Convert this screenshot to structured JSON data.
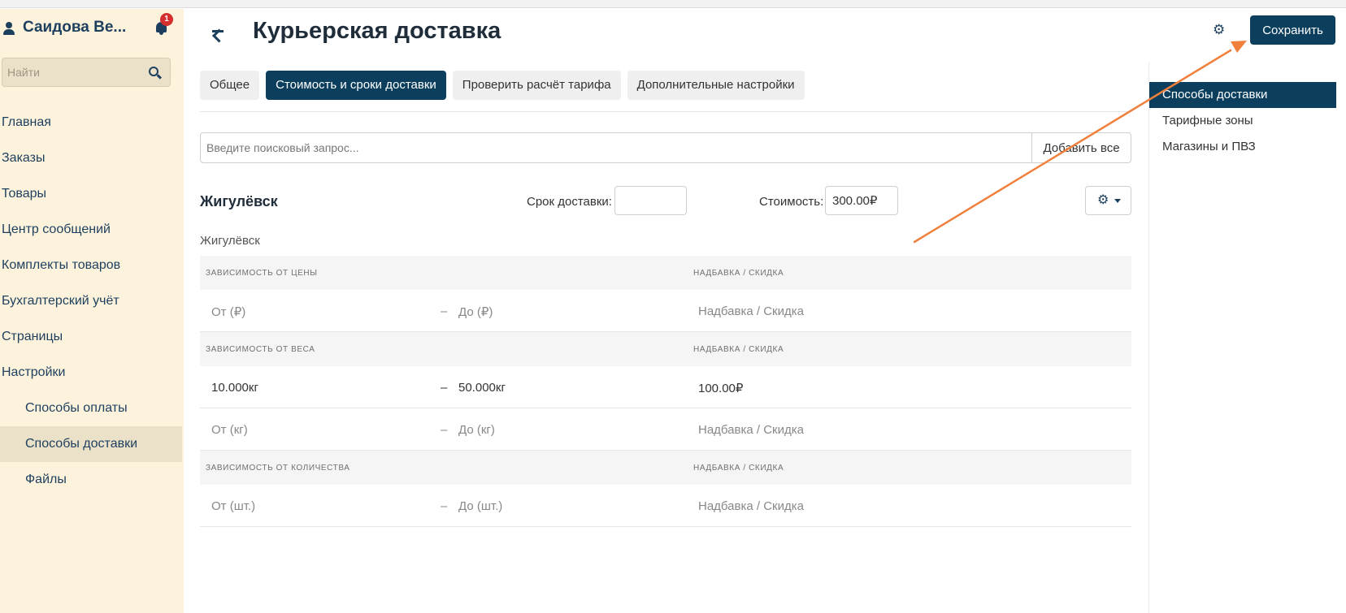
{
  "sidebar": {
    "user_name": "Саидова Ве...",
    "notification_count": "1",
    "search_placeholder": "Найти",
    "items": [
      {
        "label": "Главная"
      },
      {
        "label": "Заказы"
      },
      {
        "label": "Товары"
      },
      {
        "label": "Центр сообщений"
      },
      {
        "label": "Комплекты товаров"
      },
      {
        "label": "Бухгалтерский учёт"
      },
      {
        "label": "Страницы"
      },
      {
        "label": "Настройки"
      },
      {
        "label": "Способы оплаты"
      },
      {
        "label": "Способы доставки",
        "active": true
      },
      {
        "label": "Файлы"
      }
    ]
  },
  "header": {
    "title": "Курьерская доставка",
    "save_label": "Сохранить"
  },
  "tabs": [
    {
      "label": "Общее"
    },
    {
      "label": "Стоимость и сроки доставки",
      "active": true
    },
    {
      "label": "Проверить расчёт тарифа"
    },
    {
      "label": "Дополнительные настройки"
    }
  ],
  "search": {
    "placeholder": "Введите поисковый запрос...",
    "add_all_label": "Добавить все"
  },
  "zone": {
    "title": "Жигулёвск",
    "term_label": "Срок доставки:",
    "term_value": "",
    "cost_label": "Стоимость:",
    "cost_value": "300.00₽",
    "subtitle": "Жигулёвск"
  },
  "price_dependency": {
    "header": "ЗАВИСИМОСТЬ ОТ ЦЕНЫ",
    "markup_header": "НАДБАВКА / СКИДКА",
    "rows": [
      {
        "from": "От (₽)",
        "dash": "–",
        "to": "До (₽)",
        "markup": "Надбавка / Скидка"
      }
    ]
  },
  "weight_dependency": {
    "header": "ЗАВИСИМОСТЬ ОТ ВЕСА",
    "markup_header": "НАДБАВКА / СКИДКА",
    "rows": [
      {
        "from": "10.000кг",
        "dash": "–",
        "to": "50.000кг",
        "markup": "100.00₽"
      },
      {
        "from": "От (кг)",
        "dash": "–",
        "to": "До (кг)",
        "markup": "Надбавка / Скидка"
      }
    ]
  },
  "quantity_dependency": {
    "header": "ЗАВИСИМОСТЬ ОТ КОЛИЧЕСТВА",
    "markup_header": "НАДБАВКА / СКИДКА",
    "rows": [
      {
        "from": "От (шт.)",
        "dash": "–",
        "to": "До (шт.)",
        "markup": "Надбавка / Скидка"
      }
    ]
  },
  "right_panel": {
    "items": [
      {
        "label": "Способы доставки",
        "active": true
      },
      {
        "label": "Тарифные зоны"
      },
      {
        "label": "Магазины и ПВЗ"
      }
    ]
  },
  "colors": {
    "primary": "#0c3f5e",
    "sidebar_bg": "#fdf3dd",
    "annotation_arrow": "#f0803c",
    "badge": "#d32f2f"
  }
}
